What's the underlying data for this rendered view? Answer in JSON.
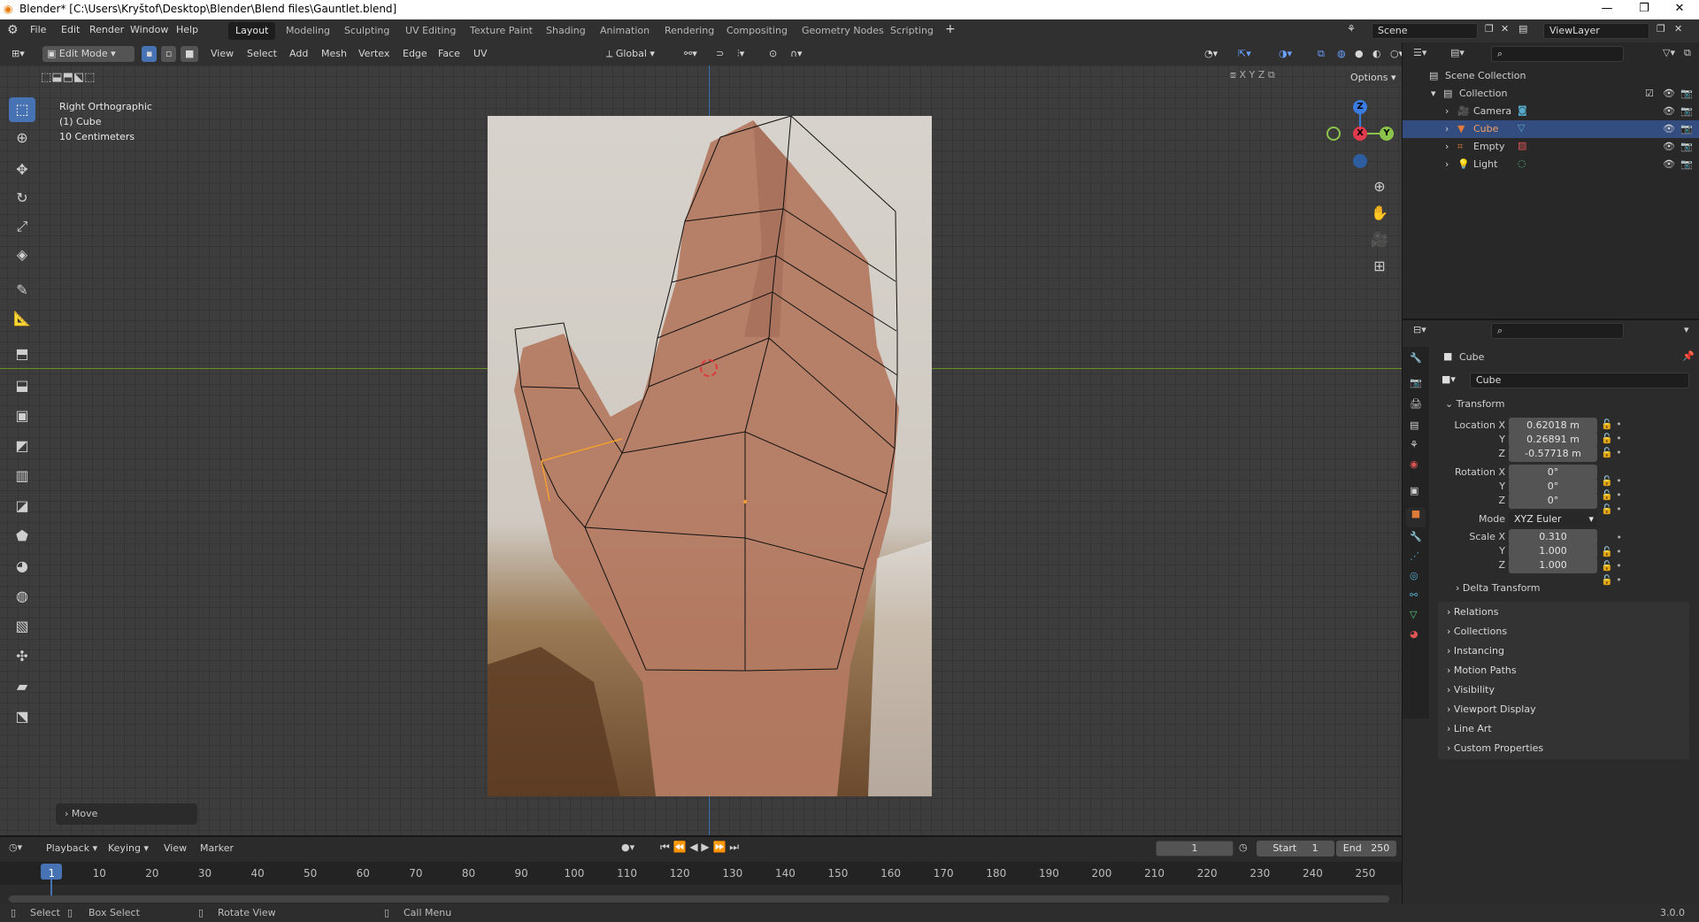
{
  "window": {
    "title": "Blender* [C:\\Users\\Kryštof\\Desktop\\Blender\\Blend files\\Gauntlet.blend]"
  },
  "menus": [
    "File",
    "Edit",
    "Render",
    "Window",
    "Help"
  ],
  "workspaces": [
    "Layout",
    "Modeling",
    "Sculpting",
    "UV Editing",
    "Texture Paint",
    "Shading",
    "Animation",
    "Rendering",
    "Compositing",
    "Geometry Nodes",
    "Scripting"
  ],
  "scene": "Scene",
  "view_layer": "ViewLayer",
  "viewport_header": {
    "mode": "Edit Mode",
    "menus": [
      "View",
      "Select",
      "Add",
      "Mesh",
      "Vertex",
      "Edge",
      "Face",
      "UV"
    ],
    "orientation": "Global",
    "options": "Options",
    "axes": [
      "X",
      "Y",
      "Z"
    ]
  },
  "viewport_overlay": {
    "view_name": "Right Orthographic",
    "object": "(1) Cube",
    "scale": "10 Centimeters"
  },
  "last_op": "Move",
  "gizmo": {
    "z": "Z",
    "x": "X",
    "y": "Y"
  },
  "outliner": {
    "root": "Scene Collection",
    "collection": "Collection",
    "items": [
      {
        "label": "Camera",
        "color": "#e07a3a"
      },
      {
        "label": "Cube",
        "color": "#e07a3a"
      },
      {
        "label": "Empty",
        "color": "#e07a3a"
      },
      {
        "label": "Light",
        "color": "#e07a3a"
      }
    ]
  },
  "properties": {
    "object_name": "Cube",
    "data_name": "Cube",
    "transform_title": "Transform",
    "location": {
      "label_x": "Location X",
      "label_y": "Y",
      "label_z": "Z",
      "x": "0.62018 m",
      "y": "0.26891 m",
      "z": "-0.57718 m"
    },
    "rotation": {
      "label_x": "Rotation X",
      "label_y": "Y",
      "label_z": "Z",
      "x": "0°",
      "y": "0°",
      "z": "0°"
    },
    "mode_label": "Mode",
    "mode": "XYZ Euler",
    "scale": {
      "label_x": "Scale X",
      "label_y": "Y",
      "label_z": "Z",
      "x": "0.310",
      "y": "1.000",
      "z": "1.000"
    },
    "delta": "Delta Transform",
    "panels": [
      "Relations",
      "Collections",
      "Instancing",
      "Motion Paths",
      "Visibility",
      "Viewport Display",
      "Line Art",
      "Custom Properties"
    ]
  },
  "timeline": {
    "menus": [
      "Playback",
      "Keying",
      "View",
      "Marker"
    ],
    "current_frame": "1",
    "start_label": "Start",
    "start": "1",
    "end_label": "End",
    "end": "250",
    "frames": [
      "1",
      "10",
      "20",
      "30",
      "40",
      "50",
      "60",
      "70",
      "80",
      "90",
      "100",
      "110",
      "120",
      "130",
      "140",
      "150",
      "160",
      "170",
      "180",
      "190",
      "200",
      "210",
      "220",
      "230",
      "240",
      "250"
    ]
  },
  "status": {
    "select": "Select",
    "box_select": "Box Select",
    "rotate_view": "Rotate View",
    "call_menu": "Call Menu",
    "version": "3.0.0"
  },
  "colors": {
    "accent": "#4772b3",
    "selected": "#e07a3a",
    "x_axis": "#e03a4d",
    "y_axis": "#8bc34a",
    "z_axis": "#3a7be0"
  }
}
